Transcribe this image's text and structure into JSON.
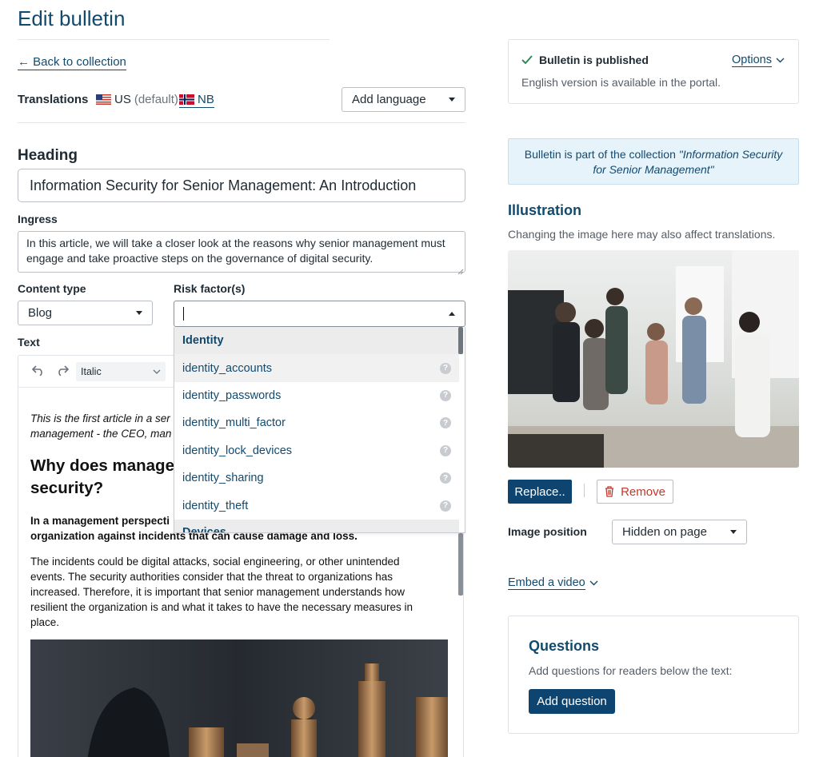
{
  "page": {
    "title": "Edit bulletin"
  },
  "nav": {
    "back_link": "← Back to collection"
  },
  "translations": {
    "label": "Translations",
    "us_code": "US",
    "us_suffix": "(default)",
    "nb_code": "NB",
    "add_language": "Add language"
  },
  "heading": {
    "label": "Heading",
    "value": "Information Security for Senior Management: An Introduction"
  },
  "ingress": {
    "label": "Ingress",
    "value": "In this article, we will take a closer look at the reasons why senior management must engage and take proactive steps on the governance of digital security."
  },
  "content_type": {
    "label": "Content type",
    "value": "Blog"
  },
  "risk_factors": {
    "label": "Risk factor(s)",
    "input_value": "",
    "group_identity": "Identity",
    "items": [
      "identity_accounts",
      "identity_passwords",
      "identity_multi_factor",
      "identity_lock_devices",
      "identity_sharing",
      "identity_theft"
    ],
    "group_next": "Devices"
  },
  "text_editor": {
    "label": "Text",
    "style_value": "Italic",
    "intro_line1": "This is the first article in a ser",
    "intro_line2": "management - the CEO, man",
    "h2_line1": "Why does manage",
    "h2_line2": "security?",
    "bold_line1": "In a management perspecti",
    "bold_line2": "organization against incidents that can cause damage and loss.",
    "paragraph": "The incidents could be digital attacks, social engineering, or other unintended events. The security authorities consider that the threat to organizations has increased. Therefore, it is important that senior management understands how resilient the organization is and what it takes to have the necessary measures in place."
  },
  "status": {
    "title": "Bulletin is published",
    "options": "Options",
    "subtitle": "English version is available in the portal."
  },
  "collection_notice": {
    "prefix": "Bulletin is part of the collection ",
    "collection_name_1": "\"Information Security",
    "collection_name_2": "for Senior Management\""
  },
  "illustration": {
    "title": "Illustration",
    "note": "Changing the image here may also affect translations.",
    "replace": "Replace..",
    "remove": "Remove",
    "position_label": "Image position",
    "position_value": "Hidden on page",
    "embed_video": "Embed a video"
  },
  "questions": {
    "title": "Questions",
    "note": "Add questions for readers below the text:",
    "add_button": "Add question"
  },
  "colors": {
    "primary": "#0e4470",
    "link": "#124a6e",
    "notice_bg": "#e6f3fb",
    "remove_red": "#c0392b"
  }
}
